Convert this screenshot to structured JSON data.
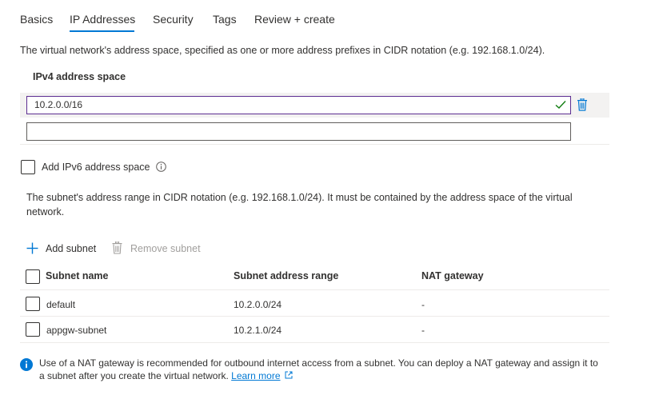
{
  "tabs": [
    {
      "label": "Basics"
    },
    {
      "label": "IP Addresses"
    },
    {
      "label": "Security"
    },
    {
      "label": "Tags"
    },
    {
      "label": "Review + create"
    }
  ],
  "active_tab": "IP Addresses",
  "address_space": {
    "description": "The virtual network's address space, specified as one or more address prefixes in CIDR notation (e.g. 192.168.1.0/24).",
    "ipv4_label": "IPv4 address space",
    "ipv4_value": "10.2.0.0/16",
    "empty_value": "",
    "ipv6_label": "Add IPv6 address space"
  },
  "subnets": {
    "description": "The subnet's address range in CIDR notation (e.g. 192.168.1.0/24). It must be contained by the address space of the virtual network.",
    "add_label": "Add subnet",
    "remove_label": "Remove subnet",
    "columns": [
      "Subnet name",
      "Subnet address range",
      "NAT gateway"
    ],
    "rows": [
      {
        "name": "default",
        "range": "10.2.0.0/24",
        "nat": "-"
      },
      {
        "name": "appgw-subnet",
        "range": "10.2.1.0/24",
        "nat": "-"
      }
    ]
  },
  "info": {
    "text": "Use of a NAT gateway is recommended for outbound internet access from a subnet. You can deploy a NAT gateway and assign it to a subnet after you create the virtual network.",
    "link": "Learn more"
  },
  "colors": {
    "accent": "#0078d4",
    "input_focus_border": "#5c2d91",
    "check": "#107c10"
  }
}
